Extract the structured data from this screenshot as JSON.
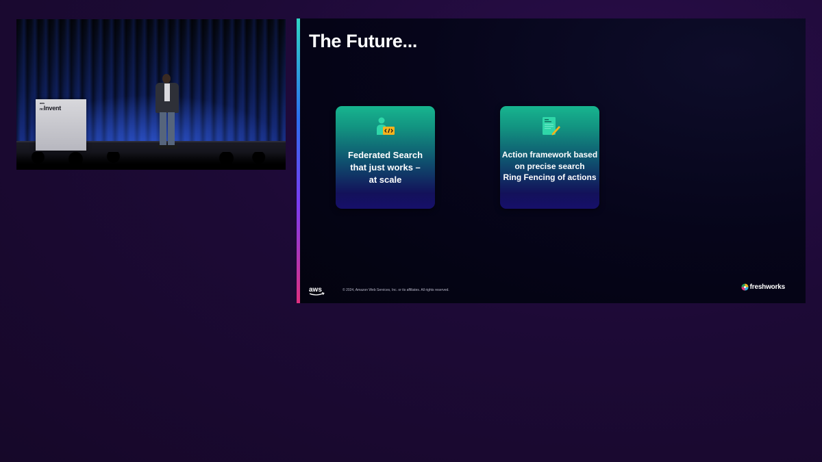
{
  "video": {
    "podium_brand_small": "aws",
    "podium_brand_prefix": "re:",
    "podium_brand": "Invent"
  },
  "slide": {
    "title": "The Future...",
    "cards": [
      {
        "lines": [
          "Federated Search",
          "that just works –",
          "at scale"
        ],
        "icon": "developer-code-icon"
      },
      {
        "lines": [
          "Action framework based",
          "on precise search",
          "Ring Fencing of actions"
        ],
        "icon": "document-edit-icon"
      }
    ],
    "footer": {
      "aws_logo": "aws",
      "copyright": "© 2024, Amazon Web Services, Inc. or its affiliates. All rights reserved.",
      "brand": "freshworks"
    }
  },
  "colors": {
    "accent_teal": "#17b58f",
    "accent_blue": "#2b6ff0",
    "accent_pink": "#e0307e",
    "background": "#1d0a36"
  }
}
